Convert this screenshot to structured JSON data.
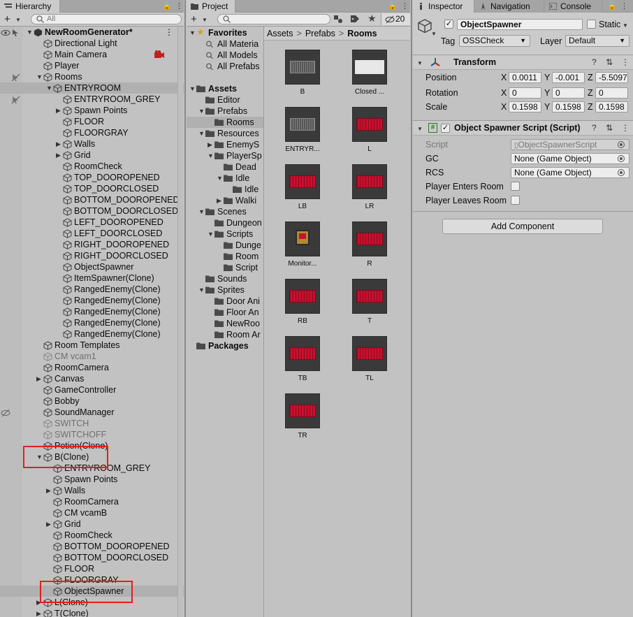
{
  "hierarchy": {
    "tab": "Hierarchy",
    "search_placeholder": "All",
    "rows": [
      {
        "label": "NewRoomGenerator*",
        "indent": 0,
        "arrow": "down",
        "bold": true
      },
      {
        "label": "Directional Light",
        "indent": 1
      },
      {
        "label": "Main Camera",
        "indent": 1
      },
      {
        "label": "Player",
        "indent": 1
      },
      {
        "label": "Rooms",
        "indent": 1,
        "arrow": "down"
      },
      {
        "label": "ENTRYROOM",
        "indent": 2,
        "arrow": "down",
        "selected": true
      },
      {
        "label": "ENTRYROOM_GREY",
        "indent": 3
      },
      {
        "label": "Spawn Points",
        "indent": 3,
        "arrow": "right"
      },
      {
        "label": "FLOOR",
        "indent": 3
      },
      {
        "label": "FLOORGRAY",
        "indent": 3
      },
      {
        "label": "Walls",
        "indent": 3,
        "arrow": "right"
      },
      {
        "label": "Grid",
        "indent": 3,
        "arrow": "right"
      },
      {
        "label": "RoomCheck",
        "indent": 3
      },
      {
        "label": "TOP_DOOROPENED",
        "indent": 3
      },
      {
        "label": "TOP_DOORCLOSED",
        "indent": 3
      },
      {
        "label": "BOTTOM_DOOROPENED",
        "indent": 3
      },
      {
        "label": "BOTTOM_DOORCLOSED",
        "indent": 3
      },
      {
        "label": "LEFT_DOOROPENED",
        "indent": 3
      },
      {
        "label": "LEFT_DOORCLOSED",
        "indent": 3
      },
      {
        "label": "RIGHT_DOOROPENED",
        "indent": 3
      },
      {
        "label": "RIGHT_DOORCLOSED",
        "indent": 3
      },
      {
        "label": "ObjectSpawner",
        "indent": 3
      },
      {
        "label": "ItemSpawner(Clone)",
        "indent": 3
      },
      {
        "label": "RangedEnemy(Clone)",
        "indent": 3
      },
      {
        "label": "RangedEnemy(Clone)",
        "indent": 3
      },
      {
        "label": "RangedEnemy(Clone)",
        "indent": 3
      },
      {
        "label": "RangedEnemy(Clone)",
        "indent": 3
      },
      {
        "label": "RangedEnemy(Clone)",
        "indent": 3
      },
      {
        "label": "Room Templates",
        "indent": 1
      },
      {
        "label": "CM vcam1",
        "indent": 1,
        "gray": true
      },
      {
        "label": "RoomCamera",
        "indent": 1
      },
      {
        "label": "Canvas",
        "indent": 1,
        "arrow": "right"
      },
      {
        "label": "GameController",
        "indent": 1
      },
      {
        "label": "Bobby",
        "indent": 1
      },
      {
        "label": "SoundManager",
        "indent": 1
      },
      {
        "label": "SWITCH",
        "indent": 1,
        "gray": true
      },
      {
        "label": "SWITCHOFF",
        "indent": 1,
        "gray": true
      },
      {
        "label": "Potion(Clone)",
        "indent": 1
      },
      {
        "label": "B(Clone)",
        "indent": 1,
        "arrow": "down"
      },
      {
        "label": "ENTRYROOM_GREY",
        "indent": 2
      },
      {
        "label": "Spawn Points",
        "indent": 2
      },
      {
        "label": "Walls",
        "indent": 2,
        "arrow": "right"
      },
      {
        "label": "RoomCamera",
        "indent": 2
      },
      {
        "label": "CM vcamB",
        "indent": 2
      },
      {
        "label": "Grid",
        "indent": 2,
        "arrow": "right"
      },
      {
        "label": "RoomCheck",
        "indent": 2
      },
      {
        "label": "BOTTOM_DOOROPENED",
        "indent": 2
      },
      {
        "label": "BOTTOM_DOORCLOSED",
        "indent": 2
      },
      {
        "label": "FLOOR",
        "indent": 2
      },
      {
        "label": "FLOORGRAY",
        "indent": 2
      },
      {
        "label": "ObjectSpawner",
        "indent": 2,
        "selected": true
      },
      {
        "label": "L(Clone)",
        "indent": 1,
        "arrow": "right"
      },
      {
        "label": "T(Clone)",
        "indent": 1,
        "arrow": "right"
      }
    ]
  },
  "project": {
    "tab": "Project",
    "hidden_count": "20",
    "breadcrumb": [
      "Assets",
      "Prefabs",
      "Rooms"
    ],
    "tree": [
      {
        "label": "Favorites",
        "indent": 0,
        "arrow": "down",
        "bold": true,
        "star": true
      },
      {
        "label": "All Materia",
        "indent": 1,
        "search": true
      },
      {
        "label": "All Models",
        "indent": 1,
        "search": true
      },
      {
        "label": "All Prefabs",
        "indent": 1,
        "search": true
      },
      {
        "label": "",
        "indent": 0,
        "spacer": true
      },
      {
        "label": "Assets",
        "indent": 0,
        "arrow": "down",
        "bold": true
      },
      {
        "label": "Editor",
        "indent": 1
      },
      {
        "label": "Prefabs",
        "indent": 1,
        "arrow": "down"
      },
      {
        "label": "Rooms",
        "indent": 2,
        "selected": true
      },
      {
        "label": "Resources",
        "indent": 1,
        "arrow": "down"
      },
      {
        "label": "EnemyS",
        "indent": 2,
        "arrow": "right"
      },
      {
        "label": "PlayerSp",
        "indent": 2,
        "arrow": "down"
      },
      {
        "label": "Dead",
        "indent": 3
      },
      {
        "label": "Idle",
        "indent": 3,
        "arrow": "down"
      },
      {
        "label": "Idle",
        "indent": 4
      },
      {
        "label": "Walki",
        "indent": 3,
        "arrow": "right"
      },
      {
        "label": "Scenes",
        "indent": 1,
        "arrow": "down"
      },
      {
        "label": "Dungeon",
        "indent": 2
      },
      {
        "label": "Scripts",
        "indent": 2,
        "arrow": "down"
      },
      {
        "label": "Dunge",
        "indent": 3
      },
      {
        "label": "Room",
        "indent": 3
      },
      {
        "label": "Script",
        "indent": 3
      },
      {
        "label": "Sounds",
        "indent": 1
      },
      {
        "label": "Sprites",
        "indent": 1,
        "arrow": "down"
      },
      {
        "label": "Door Ani",
        "indent": 2
      },
      {
        "label": "Floor An",
        "indent": 2
      },
      {
        "label": "NewRoo",
        "indent": 2
      },
      {
        "label": "Room Ar",
        "indent": 2
      },
      {
        "label": "Packages",
        "indent": 0,
        "bold": true
      }
    ],
    "assets": [
      {
        "label": "B",
        "kind": "dark"
      },
      {
        "label": "Closed ...",
        "kind": "white"
      },
      {
        "label": "ENTRYR...",
        "kind": "dark"
      },
      {
        "label": "L",
        "kind": "red"
      },
      {
        "label": "LB",
        "kind": "red"
      },
      {
        "label": "LR",
        "kind": "red"
      },
      {
        "label": "Monitor...",
        "kind": "monitor"
      },
      {
        "label": "R",
        "kind": "red"
      },
      {
        "label": "RB",
        "kind": "red"
      },
      {
        "label": "T",
        "kind": "red"
      },
      {
        "label": "TB",
        "kind": "red"
      },
      {
        "label": "TL",
        "kind": "red"
      },
      {
        "label": "TR",
        "kind": "red"
      }
    ]
  },
  "inspector": {
    "tabs": [
      "Inspector",
      "Navigation",
      "Console"
    ],
    "object_name": "ObjectSpawner",
    "static_label": "Static",
    "tag_label": "Tag",
    "tag_value": "OSSCheck",
    "layer_label": "Layer",
    "layer_value": "Default",
    "transform": {
      "title": "Transform",
      "position_label": "Position",
      "rotation_label": "Rotation",
      "scale_label": "Scale",
      "position": [
        "0.0011",
        "-0.001",
        "-5.5097"
      ],
      "rotation": [
        "0",
        "0",
        "0"
      ],
      "scale": [
        "0.1598",
        "0.1598",
        "0.1598"
      ]
    },
    "script_component": {
      "title": "Object Spawner Script (Script)",
      "script_label": "Script",
      "script_value": "ObjectSpawnerScript",
      "gc_label": "GC",
      "gc_value": "None (Game Object)",
      "rcs_label": "RCS",
      "rcs_value": "None (Game Object)",
      "enters_label": "Player Enters Room",
      "leaves_label": "Player Leaves Room"
    },
    "add_component": "Add Component"
  },
  "colors": {
    "accent_red": "#e02020",
    "thumb_red": "#c8102e",
    "panel_bg": "#c2c2c2"
  }
}
